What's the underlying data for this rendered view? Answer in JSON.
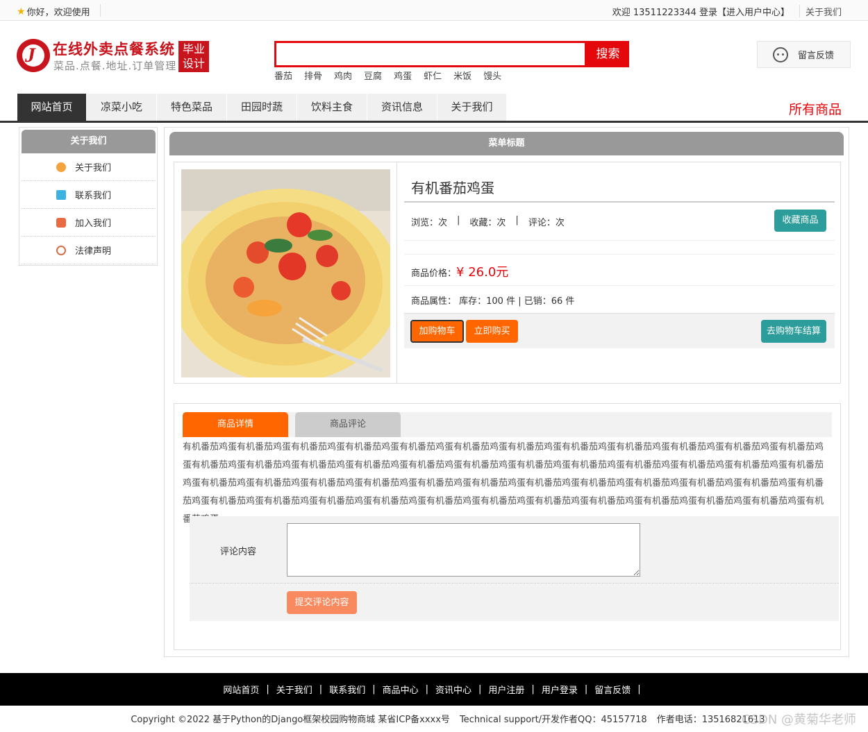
{
  "topbar": {
    "welcome": "你好，欢迎使用",
    "user_text": "欢迎 13511223344 登录【进入用户中心】",
    "about": "关于我们"
  },
  "logo": {
    "title": "在线外卖点餐系统",
    "subtitle": "菜品.点餐.地址.订单管理",
    "tag_line1": "毕业",
    "tag_line2": "设计"
  },
  "search": {
    "value": "",
    "button": "搜索",
    "hotwords": [
      "番茄",
      "排骨",
      "鸡肉",
      "豆腐",
      "鸡蛋",
      "虾仁",
      "米饭",
      "馒头"
    ]
  },
  "feedback": {
    "label": "留言反馈"
  },
  "nav": {
    "items": [
      "网站首页",
      "凉菜小吃",
      "特色菜品",
      "田园时蔬",
      "饮料主食",
      "资讯信息",
      "关于我们"
    ],
    "all_products": "所有商品"
  },
  "sidebar": {
    "title": "关于我们",
    "items": [
      "关于我们",
      "联系我们",
      "加入我们",
      "法律声明"
    ]
  },
  "main": {
    "title": "菜单标题"
  },
  "product": {
    "name": "有机番茄鸡蛋",
    "browse": "浏览：次",
    "favorites": "收藏：次",
    "comments": "评论：次",
    "collect_button": "收藏商品",
    "price_label": "商品价格：",
    "price_value": "¥ 26.0元",
    "attr_text": "商品属性： 库存：100 件 | 已销：66 件",
    "add_cart": "加购物车",
    "buy_now": "立即购买",
    "checkout": "去购物车结算"
  },
  "detail": {
    "tab_details": "商品详情",
    "tab_reviews": "商品评论",
    "description": "有机番茄鸡蛋有机番茄鸡蛋有机番茄鸡蛋有机番茄鸡蛋有机番茄鸡蛋有机番茄鸡蛋有机番茄鸡蛋有机番茄鸡蛋有机番茄鸡蛋有机番茄鸡蛋有机番茄鸡蛋有机番茄鸡蛋有机番茄鸡蛋有机番茄鸡蛋有机番茄鸡蛋有机番茄鸡蛋有机番茄鸡蛋有机番茄鸡蛋有机番茄鸡蛋有机番茄鸡蛋有机番茄鸡蛋有机番茄鸡蛋有机番茄鸡蛋有机番茄鸡蛋有机番茄鸡蛋有机番茄鸡蛋有机番茄鸡蛋有机番茄鸡蛋有机番茄鸡蛋有机番茄鸡蛋有机番茄鸡蛋有机番茄鸡蛋有机番茄鸡蛋有机番茄鸡蛋有机番茄鸡蛋有机番茄鸡蛋有机番茄鸡蛋有机番茄鸡蛋有机番茄鸡蛋有机番茄鸡蛋有机番茄鸡蛋有机番茄鸡蛋有机番茄鸡蛋有机番茄鸡蛋有机番茄鸡蛋有机番茄鸡蛋有机番茄鸡蛋有机番茄鸡蛋",
    "comment_label": "评论内容",
    "comment_value": "",
    "submit": "提交评论内容"
  },
  "footer": {
    "links": [
      "网站首页",
      "关于我们",
      "联系我们",
      "商品中心",
      "资讯中心",
      "用户注册",
      "用户登录",
      "留言反馈"
    ],
    "copyright": "Copyright ©2022 基于Python的Django框架校园购物商城 某省ICP备xxxx号",
    "support": "Technical support/开发作者QQ：45157718",
    "phone": "作者电话：13516821613"
  },
  "watermark": "CSDN @黄菊华老师",
  "colors": {
    "brand_red": "#c8151d",
    "search_red": "#e4070c",
    "orange": "#ff6600",
    "teal": "#2c9d9a",
    "header_gray": "#999999"
  }
}
